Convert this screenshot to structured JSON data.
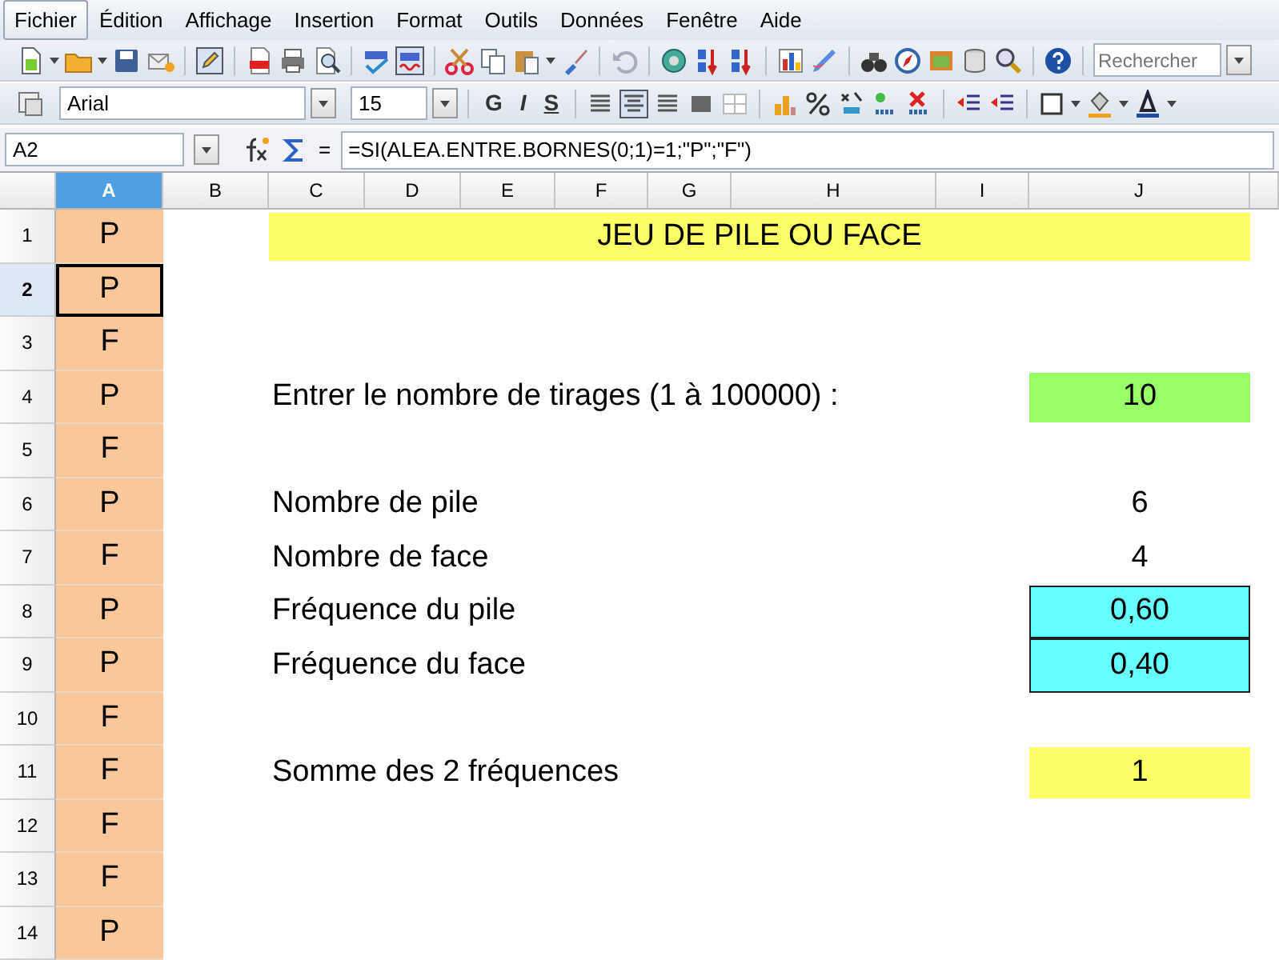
{
  "menu": [
    {
      "label": "Fichier",
      "selected": true
    },
    {
      "label": "Édition",
      "selected": false
    },
    {
      "label": "Affichage",
      "selected": false
    },
    {
      "label": "Insertion",
      "selected": false
    },
    {
      "label": "Format",
      "selected": false
    },
    {
      "label": "Outils",
      "selected": false
    },
    {
      "label": "Données",
      "selected": false
    },
    {
      "label": "Fenêtre",
      "selected": false
    },
    {
      "label": "Aide",
      "selected": false
    }
  ],
  "search": {
    "placeholder": "Rechercher"
  },
  "format_bar": {
    "font": "Arial",
    "size": "15",
    "style_buttons": [
      "G",
      "I",
      "S"
    ]
  },
  "formula_bar": {
    "cell": "A2",
    "equals": "=",
    "formula": "=SI(ALEA.ENTRE.BORNES(0;1)=1;\"P\";\"F\")"
  },
  "columns": [
    {
      "label": "A",
      "selected": true
    },
    {
      "label": "B",
      "selected": false
    },
    {
      "label": "C",
      "selected": false
    },
    {
      "label": "D",
      "selected": false
    },
    {
      "label": "E",
      "selected": false
    },
    {
      "label": "F",
      "selected": false
    },
    {
      "label": "G",
      "selected": false
    },
    {
      "label": "H",
      "selected": false
    },
    {
      "label": "I",
      "selected": false
    },
    {
      "label": "J",
      "selected": false
    }
  ],
  "rows": [
    {
      "number": "1",
      "a": "P",
      "selected": false,
      "title": "JEU DE PILE OU FACE"
    },
    {
      "number": "2",
      "a": "P",
      "selected": true
    },
    {
      "number": "3",
      "a": "F",
      "selected": false
    },
    {
      "number": "4",
      "a": "P",
      "selected": false,
      "label": "Entrer le nombre de tirages (1 à 100000) :",
      "value": "10",
      "kind": "input"
    },
    {
      "number": "5",
      "a": "F",
      "selected": false
    },
    {
      "number": "6",
      "a": "P",
      "selected": false,
      "label": "Nombre de pile",
      "value": "6",
      "kind": "plain"
    },
    {
      "number": "7",
      "a": "F",
      "selected": false,
      "label": "Nombre de face",
      "value": "4",
      "kind": "plain"
    },
    {
      "number": "8",
      "a": "P",
      "selected": false,
      "label": "Fréquence du pile",
      "value": "0,60",
      "kind": "result"
    },
    {
      "number": "9",
      "a": "P",
      "selected": false,
      "label": "Fréquence du face",
      "value": "0,40",
      "kind": "result"
    },
    {
      "number": "10",
      "a": "F",
      "selected": false
    },
    {
      "number": "11",
      "a": "F",
      "selected": false,
      "label": "Somme des 2 fréquences",
      "value": "1",
      "kind": "sum"
    },
    {
      "number": "12",
      "a": "F",
      "selected": false
    },
    {
      "number": "13",
      "a": "F",
      "selected": false
    },
    {
      "number": "14",
      "a": "P",
      "selected": false
    }
  ]
}
